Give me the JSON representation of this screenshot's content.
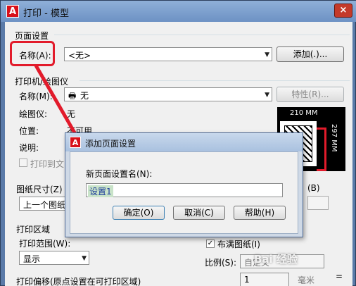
{
  "window": {
    "title": "打印 - 模型",
    "app_icon": "A",
    "close": "×"
  },
  "page_setup": {
    "section": "页面设置",
    "name_label": "名称(A):",
    "name_value": "<无>",
    "add_button": "添加(.)..."
  },
  "printer": {
    "section": "打印机/绘图仪",
    "name_label": "名称(M):",
    "name_value": "无",
    "properties_button": "特性(R)...",
    "plotter_label": "绘图仪:",
    "plotter_value": "无",
    "location_label": "位置:",
    "location_value": "不可用",
    "description_label": "说明:",
    "print_to_file": "打印到文"
  },
  "preview": {
    "width": "210 MM",
    "height": "297 MM"
  },
  "paper_size": {
    "label": "图纸尺寸(Z)",
    "value": "上一个图纸",
    "copies_key": "(B)"
  },
  "plot_area": {
    "section": "打印区域",
    "range_label": "打印范围(W):",
    "range_value": "显示"
  },
  "plot_scale": {
    "fit_label": "布满图纸(I)",
    "scale_label": "比例(S):",
    "scale_value": "自定义",
    "value1": "1",
    "unit": "毫米",
    "equals": "="
  },
  "plot_offset": {
    "section": "打印偏移(原点设置在可打印区域)"
  },
  "dialog": {
    "title": "添加页面设置",
    "field_label": "新页面设置名(N):",
    "field_value": "设置1",
    "ok_button": "确定(O)",
    "cancel_button": "取消(C)",
    "help_button": "帮助(H)"
  },
  "watermark": "Bai 经验",
  "colors": {
    "accent_red": "#e21b2b",
    "selection": "#c9e3c9"
  }
}
